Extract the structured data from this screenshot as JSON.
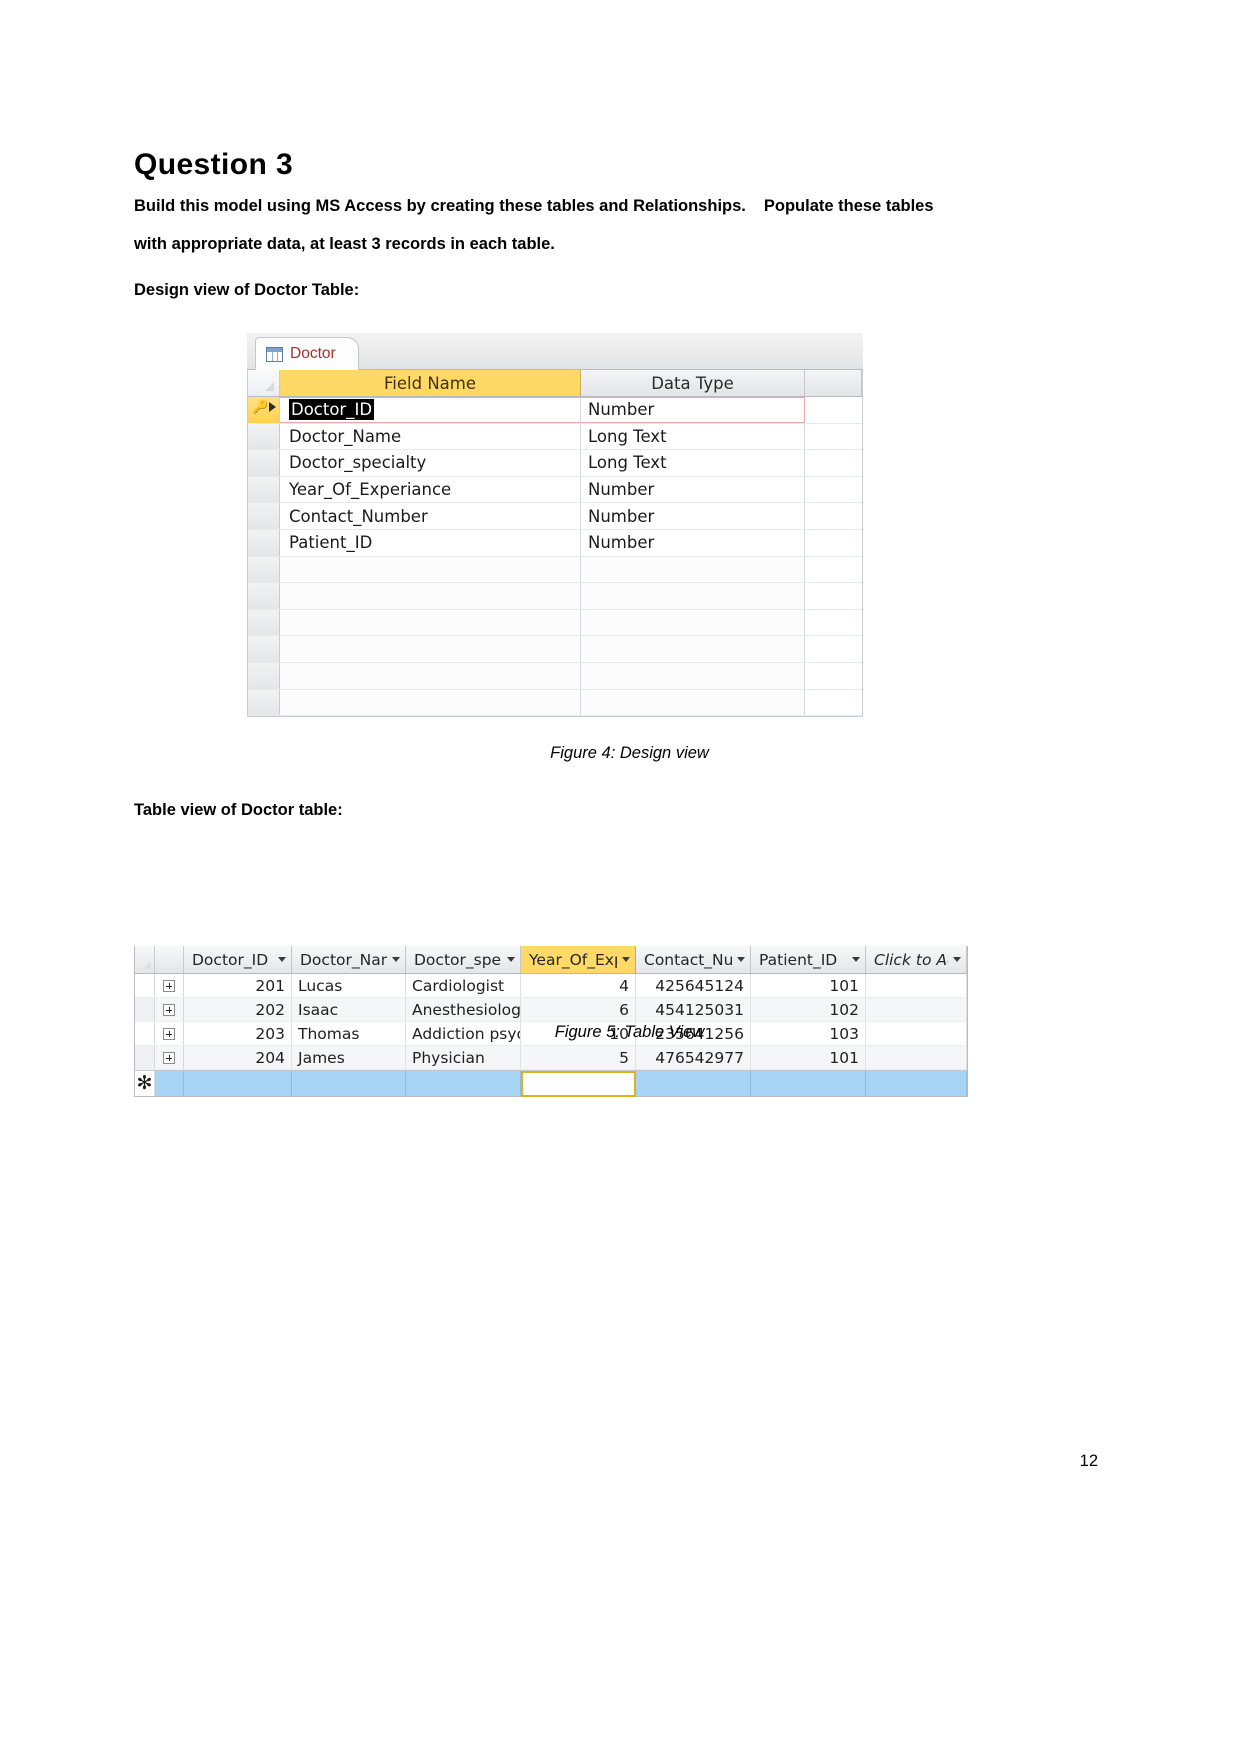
{
  "document": {
    "question_title": "Question 3",
    "intro_line1": "Build this model using MS Access by creating these tables and Relationships.",
    "intro_line1b": "Populate these",
    "intro_line2": "tables with appropriate data, at least 3 records in each table.",
    "design_label": "Design view of Doctor Table:",
    "tableview_label": "Table view of Doctor table:",
    "figure4_caption": "Figure 4: Design view",
    "figure5_caption": "Figure 5: Table View",
    "page_number": "12"
  },
  "design_view": {
    "tab_label": "Doctor",
    "tab_icon": "table-icon",
    "columns": {
      "field_name": "Field Name",
      "data_type": "Data Type"
    },
    "selected_row_index": 0,
    "primary_key_row_index": 0,
    "rows": [
      {
        "field_name": "Doctor_ID",
        "data_type": "Number"
      },
      {
        "field_name": "Doctor_Name",
        "data_type": "Long Text"
      },
      {
        "field_name": "Doctor_specialty",
        "data_type": "Long Text"
      },
      {
        "field_name": "Year_Of_Experiance",
        "data_type": "Number"
      },
      {
        "field_name": "Contact_Number",
        "data_type": "Number"
      },
      {
        "field_name": "Patient_ID",
        "data_type": "Number"
      }
    ],
    "empty_row_count": 6,
    "colors": {
      "field_name_header": "#ffd866",
      "tab_text": "#9c3434",
      "selection_outline": "#e9a9a9"
    }
  },
  "table_view": {
    "headers": [
      "Doctor_ID",
      "Doctor_Nam",
      "Doctor_spec",
      "Year_Of_Exp",
      "Contact_Nur",
      "Patient_ID"
    ],
    "add_column_label": "Click to Add",
    "active_column_index": 3,
    "rows": [
      {
        "doctor_id": "201",
        "doctor_name": "Lucas",
        "doctor_specialty": "Cardiologist",
        "year_of_exp": "4",
        "contact_number": "425645124",
        "patient_id": "101"
      },
      {
        "doctor_id": "202",
        "doctor_name": "Isaac",
        "doctor_specialty": "Anesthesiologi",
        "year_of_exp": "6",
        "contact_number": "454125031",
        "patient_id": "102"
      },
      {
        "doctor_id": "203",
        "doctor_name": "Thomas",
        "doctor_specialty": "Addiction psyc",
        "year_of_exp": "10",
        "contact_number": "235641256",
        "patient_id": "103"
      },
      {
        "doctor_id": "204",
        "doctor_name": "James",
        "doctor_specialty": "Physician",
        "year_of_exp": "5",
        "contact_number": "476542977",
        "patient_id": "101"
      }
    ],
    "new_record_marker": "✻",
    "colors": {
      "active_header": "#ffd966",
      "new_row": "#a8d4f5",
      "active_cell_border": "#e0b01f"
    }
  }
}
